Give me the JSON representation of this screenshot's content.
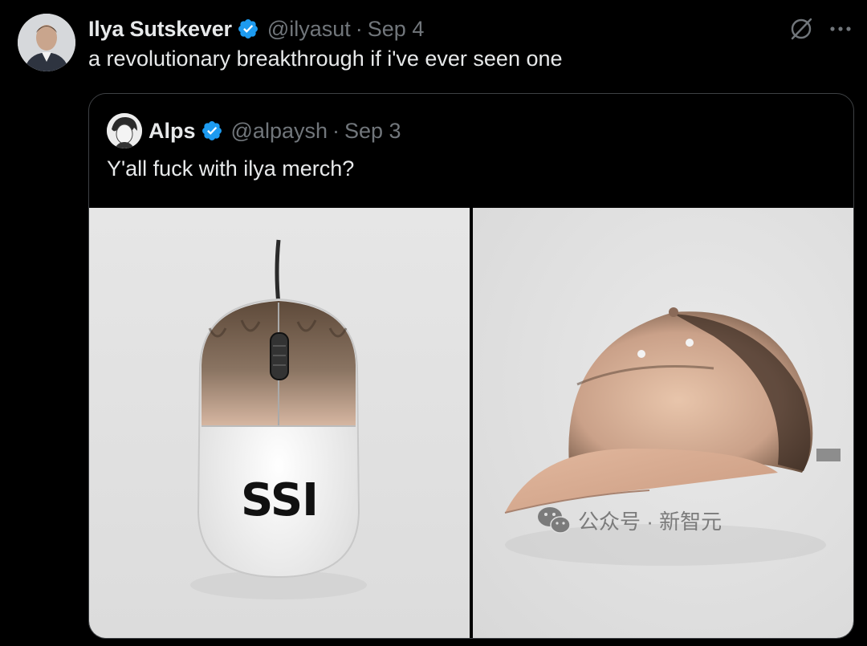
{
  "post": {
    "author_name": "Ilya Sutskever",
    "handle": "@ilyasut",
    "separator": "·",
    "date": "Sep 4",
    "text": "a revolutionary breakthrough if i've ever seen one",
    "icons": {
      "verified": "verified-badge-icon",
      "grok": "grok-icon",
      "more": "more-icon"
    }
  },
  "quote": {
    "author_name": "Alps",
    "handle": "@alpaysh",
    "separator": "·",
    "date": "Sep 3",
    "text": "Y'all fuck with ilya merch?",
    "images": [
      {
        "description_label": "mouse",
        "printed_text": "SSI"
      },
      {
        "description_label": "cap"
      }
    ]
  },
  "watermark": {
    "text": "公众号 · 新智元",
    "icon": "wechat-icon"
  },
  "colors": {
    "background": "#000000",
    "text": "#e7e9ea",
    "muted": "#71767b",
    "verified": "#1d9bf0",
    "border": "#3e4144"
  }
}
